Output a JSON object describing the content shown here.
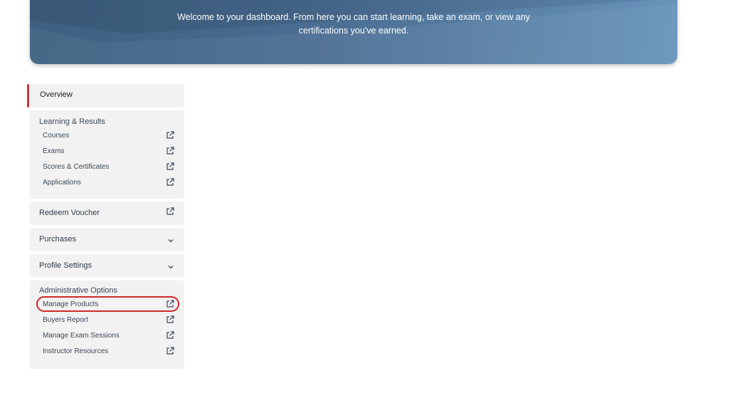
{
  "hero": {
    "line1": "Welcome to your dashboard. From here you can start learning, take an exam, or view any",
    "line2": "certifications you've earned."
  },
  "sidebar": {
    "overview": {
      "label": "Overview"
    },
    "learning": {
      "heading": "Learning & Results",
      "items": [
        {
          "label": "Courses",
          "icon": "external-link-icon"
        },
        {
          "label": "Exams",
          "icon": "external-link-icon"
        },
        {
          "label": "Scores & Certificates",
          "icon": "external-link-icon"
        },
        {
          "label": "Applications",
          "icon": "external-link-icon"
        }
      ]
    },
    "redeem": {
      "label": "Redeem Voucher",
      "icon": "external-link-icon"
    },
    "purchases": {
      "label": "Purchases",
      "icon": "chevron-down-icon"
    },
    "profile": {
      "label": "Profile Settings",
      "icon": "chevron-down-icon"
    },
    "admin": {
      "heading": "Administrative Options",
      "items": [
        {
          "label": "Manage Products",
          "icon": "external-link-icon"
        },
        {
          "label": "Buyers Report",
          "icon": "external-link-icon"
        },
        {
          "label": "Manage Exam Sessions",
          "icon": "external-link-icon"
        },
        {
          "label": "Instructor Resources",
          "icon": "external-link-icon"
        }
      ]
    }
  },
  "colors": {
    "accent": "#d0343c",
    "highlight_ring": "#cf2a2a",
    "card_bg": "#f2f2f2",
    "hero_start": "#3e5f80",
    "hero_end": "#6894bb"
  }
}
